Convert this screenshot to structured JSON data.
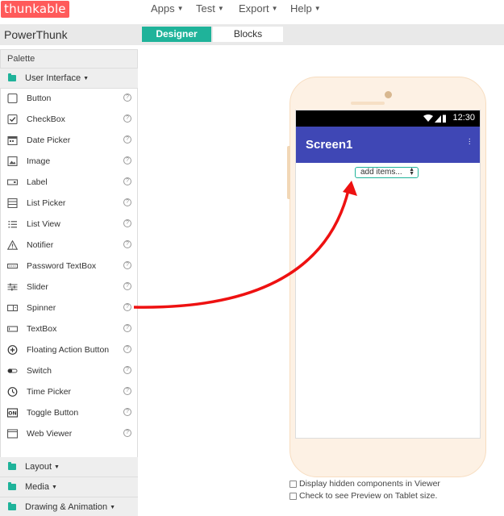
{
  "header": {
    "logo": "thunkable",
    "menus": [
      {
        "label": "Apps"
      },
      {
        "label": "Test"
      },
      {
        "label": "Export"
      },
      {
        "label": "Help"
      }
    ]
  },
  "project": {
    "name": "PowerThunk",
    "tabs": [
      {
        "label": "Designer",
        "active": true
      },
      {
        "label": "Blocks",
        "active": false
      }
    ]
  },
  "palette": {
    "title": "Palette",
    "categories": [
      {
        "label": "User Interface",
        "expanded": true
      },
      {
        "label": "Layout",
        "expanded": false
      },
      {
        "label": "Media",
        "expanded": false
      },
      {
        "label": "Drawing & Animation",
        "expanded": false
      }
    ],
    "components": [
      {
        "label": "Button",
        "icon": "button-icon"
      },
      {
        "label": "CheckBox",
        "icon": "checkbox-icon"
      },
      {
        "label": "Date Picker",
        "icon": "calendar-icon"
      },
      {
        "label": "Image",
        "icon": "image-icon"
      },
      {
        "label": "Label",
        "icon": "label-icon"
      },
      {
        "label": "List Picker",
        "icon": "list-picker-icon"
      },
      {
        "label": "List View",
        "icon": "list-view-icon"
      },
      {
        "label": "Notifier",
        "icon": "warning-icon"
      },
      {
        "label": "Password TextBox",
        "icon": "password-icon"
      },
      {
        "label": "Slider",
        "icon": "slider-icon"
      },
      {
        "label": "Spinner",
        "icon": "spinner-icon"
      },
      {
        "label": "TextBox",
        "icon": "textbox-icon"
      },
      {
        "label": "Floating Action Button",
        "icon": "plus-circle-icon"
      },
      {
        "label": "Switch",
        "icon": "switch-icon"
      },
      {
        "label": "Time Picker",
        "icon": "clock-icon"
      },
      {
        "label": "Toggle Button",
        "icon": "toggle-on-icon"
      },
      {
        "label": "Web Viewer",
        "icon": "web-viewer-icon"
      }
    ],
    "help_glyph": "?"
  },
  "viewer": {
    "status_time": "12:30",
    "screen_title": "Screen1",
    "spinner_text": "add items...",
    "options": [
      {
        "label": "Display hidden components in Viewer",
        "checked": false
      },
      {
        "label": "Check to see Preview on Tablet size.",
        "checked": false
      }
    ]
  },
  "colors": {
    "brand": "#ff5a5a",
    "accent": "#1fb39a",
    "app_bar": "#3f47b5",
    "arrow": "#ee1111"
  }
}
